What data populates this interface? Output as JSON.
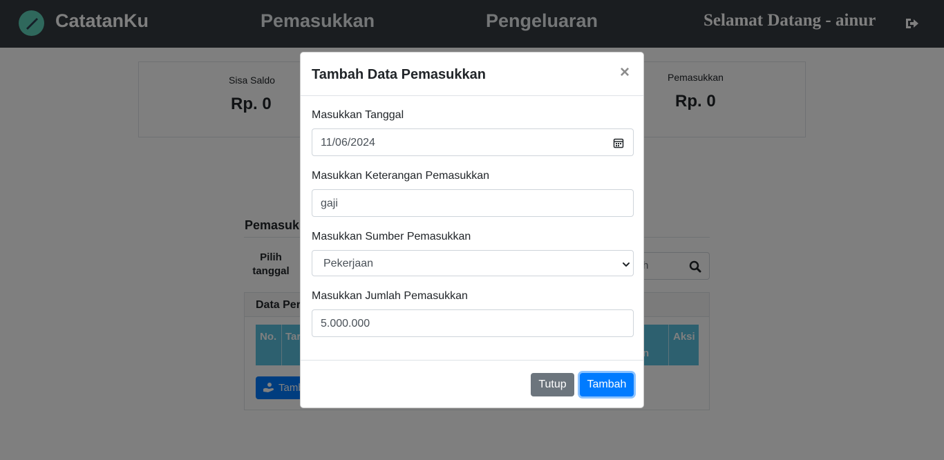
{
  "navbar": {
    "brand": "CatatanKu",
    "links": [
      "Pemasukkan",
      "Pengeluaran"
    ],
    "greeting": "Selamat Datang - ainur"
  },
  "summary": {
    "left_label": "Sisa Saldo",
    "left_value": "Rp. 0",
    "right_label": "Pemasukkan",
    "right_value": "Rp. 0"
  },
  "panel": {
    "title": "Pemasukk",
    "pick_date": "Pilih tanggal",
    "search_placeholder": "h",
    "card_header": "Data Per",
    "columns": [
      "No.",
      "Tar",
      "n",
      "Aksi"
    ],
    "add_button": "Tamb"
  },
  "modal": {
    "title": "Tambah Data Pemasukkan",
    "close_symbol": "×",
    "fields": {
      "date_label": "Masukkan Tanggal",
      "date_value": "11/06/2024",
      "desc_label": "Masukkan Keterangan Pemasukkan",
      "desc_value": "gaji",
      "source_label": "Masukkan Sumber Pemasukkan",
      "source_value": "Pekerjaan",
      "amount_label": "Masukkan Jumlah Pemasukkan",
      "amount_value": "5.000.000"
    },
    "close_button": "Tutup",
    "submit_button": "Tambah"
  },
  "colors": {
    "navbar": "#343a40",
    "primary": "#007bff",
    "secondary": "#6c757d",
    "table_header": "#5bc0de"
  }
}
